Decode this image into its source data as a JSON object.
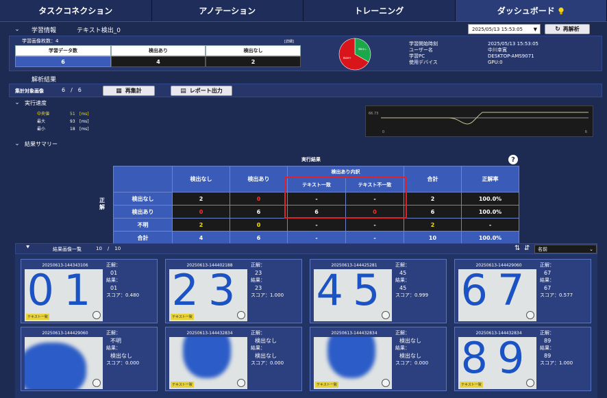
{
  "nav": {
    "tabs": [
      "タスクコネクション",
      "アノテーション",
      "トレーニング",
      "ダッシュボード"
    ]
  },
  "learning": {
    "title": "学習情報",
    "model": "テキスト検出_0",
    "datetime": "2025/05/13 15:53:05",
    "reanalyze": "再解析",
    "count_label": "学習画像枚数：4",
    "detail_label": "[詳細]",
    "table_headers": [
      "学習データ数",
      "検出あり",
      "検出なし"
    ],
    "table_values": [
      "6",
      "4",
      "2"
    ],
    "pie": {
      "slices": [
        {
          "label": "検出なし",
          "value": 2,
          "color": "#1aa84a"
        },
        {
          "label": "検出あり",
          "value": 4,
          "color": "#d9141b"
        }
      ]
    },
    "meta_labels": [
      "学習開始時刻",
      "ユーザー名",
      "学習PC",
      "使用デバイス"
    ],
    "meta_values": [
      "2025/05/13 15:53:05",
      "中川幸寛",
      "DESKTOP-AMS9071",
      "GPU:0"
    ]
  },
  "analysis": {
    "title": "解析結果",
    "count_label": "集計対象画像",
    "count_value": "6",
    "count_sep": "/",
    "count_total": "6",
    "recount": "再集計",
    "report": "レポート出力"
  },
  "speed": {
    "title": "実行速度",
    "rows": [
      {
        "label": "中央値",
        "value": "51",
        "unit": "[ms]"
      },
      {
        "label": "最大",
        "value": "93",
        "unit": "[ms]"
      },
      {
        "label": "最小",
        "value": "18",
        "unit": "[ms]"
      }
    ],
    "chart": {
      "ylabel": "66.73",
      "xstart": "0",
      "xend": "6"
    }
  },
  "summary": {
    "title": "結果サマリー",
    "table_title": "実行結果",
    "help": "?",
    "side_label": "正解",
    "col_headers": [
      "検出なし",
      "検出あり",
      "検出あり内訳",
      "テキスト一致",
      "テキスト不一致",
      "合計",
      "正解率"
    ],
    "rows": [
      {
        "label": "検出なし",
        "cells": [
          "2",
          "0",
          "-",
          "-",
          "2",
          "100.0%"
        ],
        "colors": [
          "#fff",
          "#ff3030",
          "#fff",
          "#fff",
          "#fff",
          "#fff"
        ]
      },
      {
        "label": "検出あり",
        "cells": [
          "0",
          "6",
          "6",
          "0",
          "6",
          "100.0%"
        ],
        "colors": [
          "#ff3030",
          "#fff",
          "#fff",
          "#ff3030",
          "#fff",
          "#fff"
        ]
      },
      {
        "label": "不明",
        "cells": [
          "2",
          "0",
          "-",
          "-",
          "2",
          "-"
        ],
        "colors": [
          "#f5e000",
          "#f5e000",
          "#fff",
          "#fff",
          "#f5e000",
          "#fff"
        ]
      },
      {
        "label": "合計",
        "cells": [
          "4",
          "6",
          "-",
          "-",
          "10",
          "100.0%"
        ],
        "colors": [
          "#fff",
          "#fff",
          "#fff",
          "#fff",
          "#fff",
          "#fff"
        ]
      }
    ]
  },
  "list": {
    "title": "結果画像一覧",
    "count": "10",
    "sep": "/",
    "total": "10",
    "sort": "名前",
    "label_answer": "正解：",
    "label_result": "結果：",
    "label_score": "スコア：",
    "cards": [
      {
        "id": "20250613-144343106",
        "answer": "01",
        "result": "01",
        "score": "0.480",
        "glyph": "01",
        "badge": "テキスト一致"
      },
      {
        "id": "20250613-144402188",
        "answer": "23",
        "result": "23",
        "score": "1.000",
        "glyph": "23",
        "badge": "テキスト一致"
      },
      {
        "id": "20250613-144425281",
        "answer": "45",
        "result": "45",
        "score": "0.999",
        "glyph": "45",
        "badge": ""
      },
      {
        "id": "20250613-144429060",
        "answer": "67",
        "result": "67",
        "score": "0.577",
        "glyph": "67",
        "badge": ""
      },
      {
        "id": "20250613-144429060",
        "answer": "不明",
        "result": "検出なし",
        "score": "0.000",
        "glyph": "",
        "badge": ""
      },
      {
        "id": "20250613-144432834",
        "answer": "検出なし",
        "result": "検出なし",
        "score": "0.000",
        "glyph": "",
        "badge": "テキスト一致"
      },
      {
        "id": "20250613-144432834",
        "answer": "検出なし",
        "result": "検出なし",
        "score": "0.000",
        "glyph": "",
        "badge": "テキスト一致"
      },
      {
        "id": "20250613-144432834",
        "answer": "89",
        "result": "89",
        "score": "1.000",
        "glyph": "89",
        "badge": "テキスト一致"
      }
    ]
  }
}
